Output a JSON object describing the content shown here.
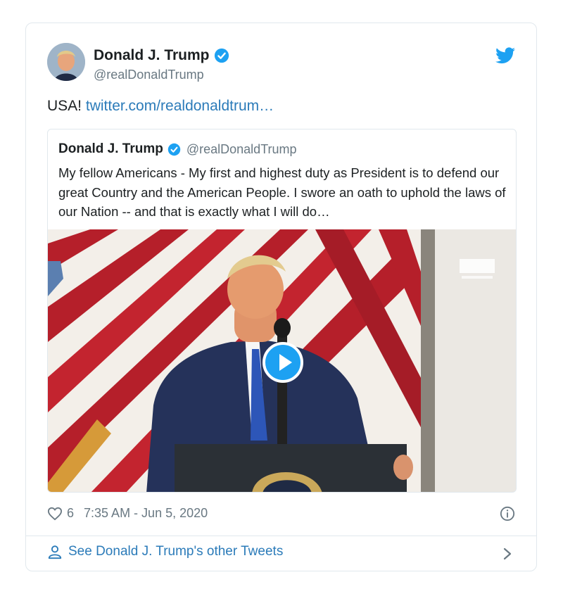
{
  "author": {
    "name": "Donald J. Trump",
    "handle": "@realDonaldTrump"
  },
  "tweet": {
    "text": "USA!",
    "link_text": "twitter.com/realdonaldtrum…"
  },
  "quoted": {
    "name": "Donald J. Trump",
    "handle": "@realDonaldTrump",
    "body": "My fellow Americans - My first and highest duty as President is to defend our great Country and the American People. I swore an oath to uphold the laws of our Nation -- and that is exactly what I will do…"
  },
  "footer": {
    "likes": "6",
    "timestamp": "7:35 AM - Jun 5, 2020"
  },
  "see_more": {
    "label": "See Donald J. Trump's other Tweets"
  },
  "icons": {
    "verified": "verified-badge-icon",
    "bird": "twitter-bird-icon",
    "play": "play-icon",
    "heart": "heart-icon",
    "info": "info-icon",
    "person": "person-icon",
    "chevron": "chevron-right-icon"
  },
  "colors": {
    "accent": "#1da1f2",
    "link": "#2b7bb9",
    "muted": "#697882"
  }
}
